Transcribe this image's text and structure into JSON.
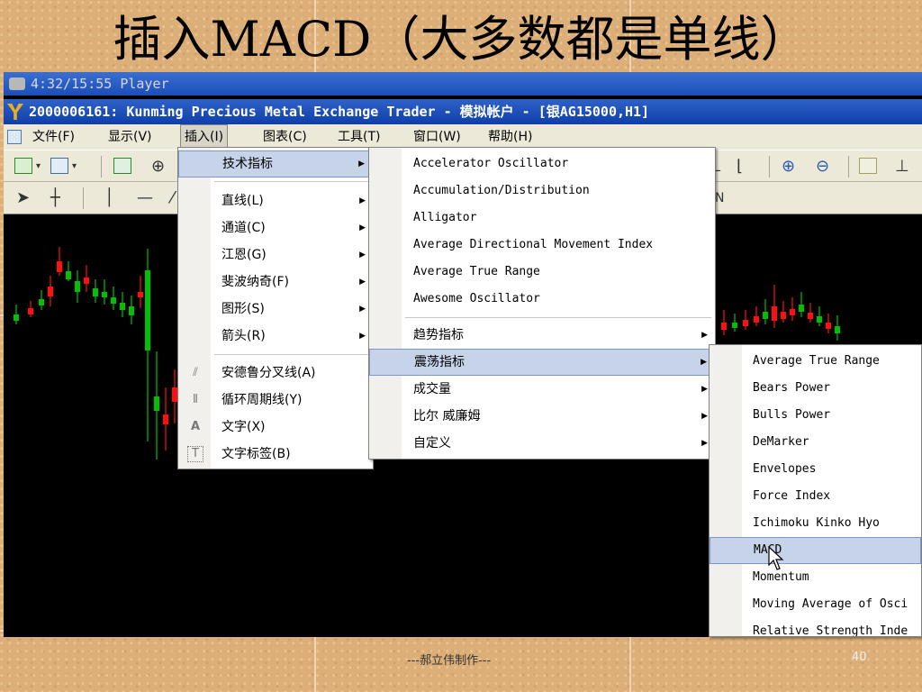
{
  "slide": {
    "title": "插入MACD（大多数都是单线）",
    "footer_credit": "---郝立伟制作---",
    "page_number": "40"
  },
  "window": {
    "player_title": "4:32/15:55 Player",
    "app_title": "2000006161: Kunming Precious Metal Exchange Trader - 模拟帐户 - [银AG15000,H1]"
  },
  "menubar": {
    "items": [
      "文件(F)",
      "显示(V)",
      "插入(I)",
      "图表(C)",
      "工具(T)",
      "窗口(W)",
      "帮助(H)"
    ],
    "active": "插入(I)"
  },
  "toolbar2": {
    "trailing_label": "N"
  },
  "insert_menu": {
    "items": [
      {
        "label": "技术指标",
        "submenu": true,
        "highlighted": true
      },
      {
        "label": "直线(L)",
        "submenu": true
      },
      {
        "label": "通道(C)",
        "submenu": true
      },
      {
        "label": "江恩(G)",
        "submenu": true
      },
      {
        "label": "斐波纳奇(F)",
        "submenu": true
      },
      {
        "label": "图形(S)",
        "submenu": true
      },
      {
        "label": "箭头(R)",
        "submenu": true
      },
      {
        "label": "安德鲁分叉线(A)",
        "icon": "pitchfork-icon"
      },
      {
        "label": "循环周期线(Y)",
        "icon": "cycle-lines-icon"
      },
      {
        "label": "文字(X)",
        "icon": "text-icon"
      },
      {
        "label": "文字标签(B)",
        "icon": "text-label-icon"
      }
    ]
  },
  "indicators_menu": {
    "items": [
      {
        "label": "Accelerator Oscillator"
      },
      {
        "label": "Accumulation/Distribution"
      },
      {
        "label": "Alligator"
      },
      {
        "label": "Average Directional Movement Index"
      },
      {
        "label": "Average True Range"
      },
      {
        "label": "Awesome Oscillator"
      },
      {
        "label": "趋势指标",
        "submenu": true
      },
      {
        "label": "震荡指标",
        "submenu": true,
        "highlighted": true
      },
      {
        "label": "成交量",
        "submenu": true
      },
      {
        "label": "比尔 威廉姆",
        "submenu": true
      },
      {
        "label": "自定义",
        "submenu": true
      }
    ]
  },
  "oscillators_menu": {
    "items": [
      {
        "label": "Average True Range"
      },
      {
        "label": "Bears Power"
      },
      {
        "label": "Bulls Power"
      },
      {
        "label": "DeMarker"
      },
      {
        "label": "Envelopes"
      },
      {
        "label": "Force Index"
      },
      {
        "label": "Ichimoku Kinko Hyo"
      },
      {
        "label": "MACD",
        "highlighted": true
      },
      {
        "label": "Momentum"
      },
      {
        "label": "Moving Average of Osci"
      },
      {
        "label": "Relative Strength Inde"
      }
    ]
  },
  "colors": {
    "bull_candle": "#00c000",
    "bear_candle": "#ff1010",
    "menu_highlight": "#c7d3e8",
    "titlebar": "#1b4eb8"
  },
  "icons": {
    "player": "camera-icon",
    "app": "y-logo-icon",
    "arrow_tool": "cursor-arrow-icon",
    "crosshair_tool": "crosshair-icon",
    "zoom_in": "zoom-in-icon",
    "zoom_out": "zoom-out-icon"
  }
}
